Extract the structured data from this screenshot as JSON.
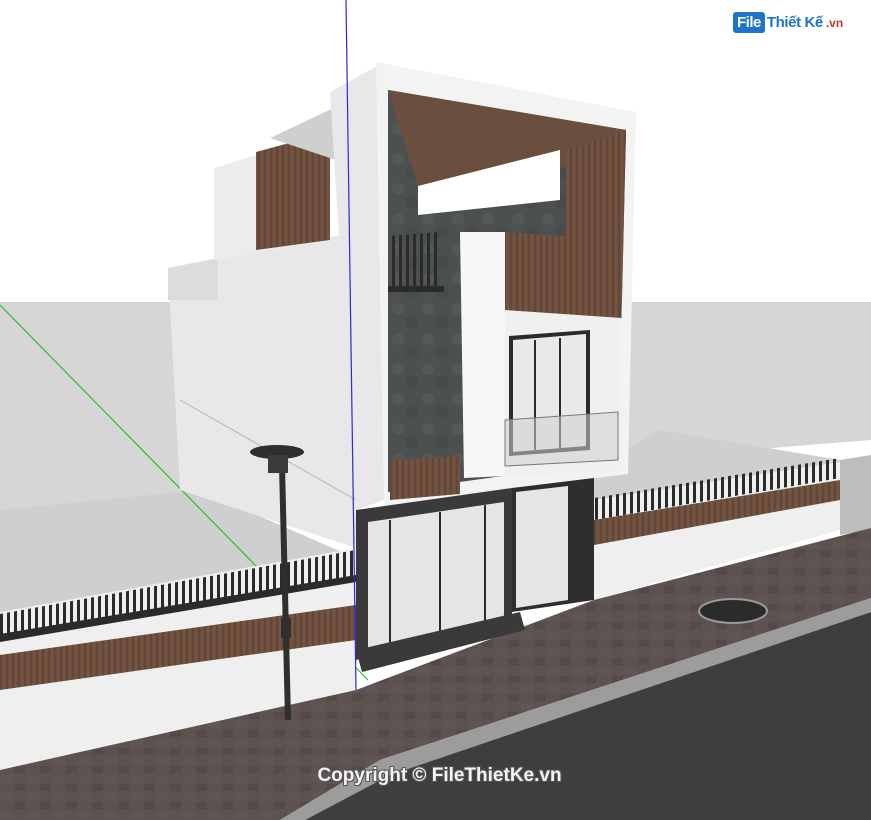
{
  "watermark": {
    "logo_box": "File",
    "logo_text": "Thiết Kế",
    "logo_domain": ".vn"
  },
  "copyright": "Copyright © FileThietKe.vn",
  "colors": {
    "sky": "#ffffff",
    "ground": "#d2d2d2",
    "wall": "#e6e6e6",
    "wood": "#6b4e3d",
    "dark": "#3c3c3c",
    "sidewalk": "#5e5350",
    "road": "#3e3e3e",
    "axis_blue": "#2a2ad8",
    "axis_green": "#2dbd2d"
  }
}
